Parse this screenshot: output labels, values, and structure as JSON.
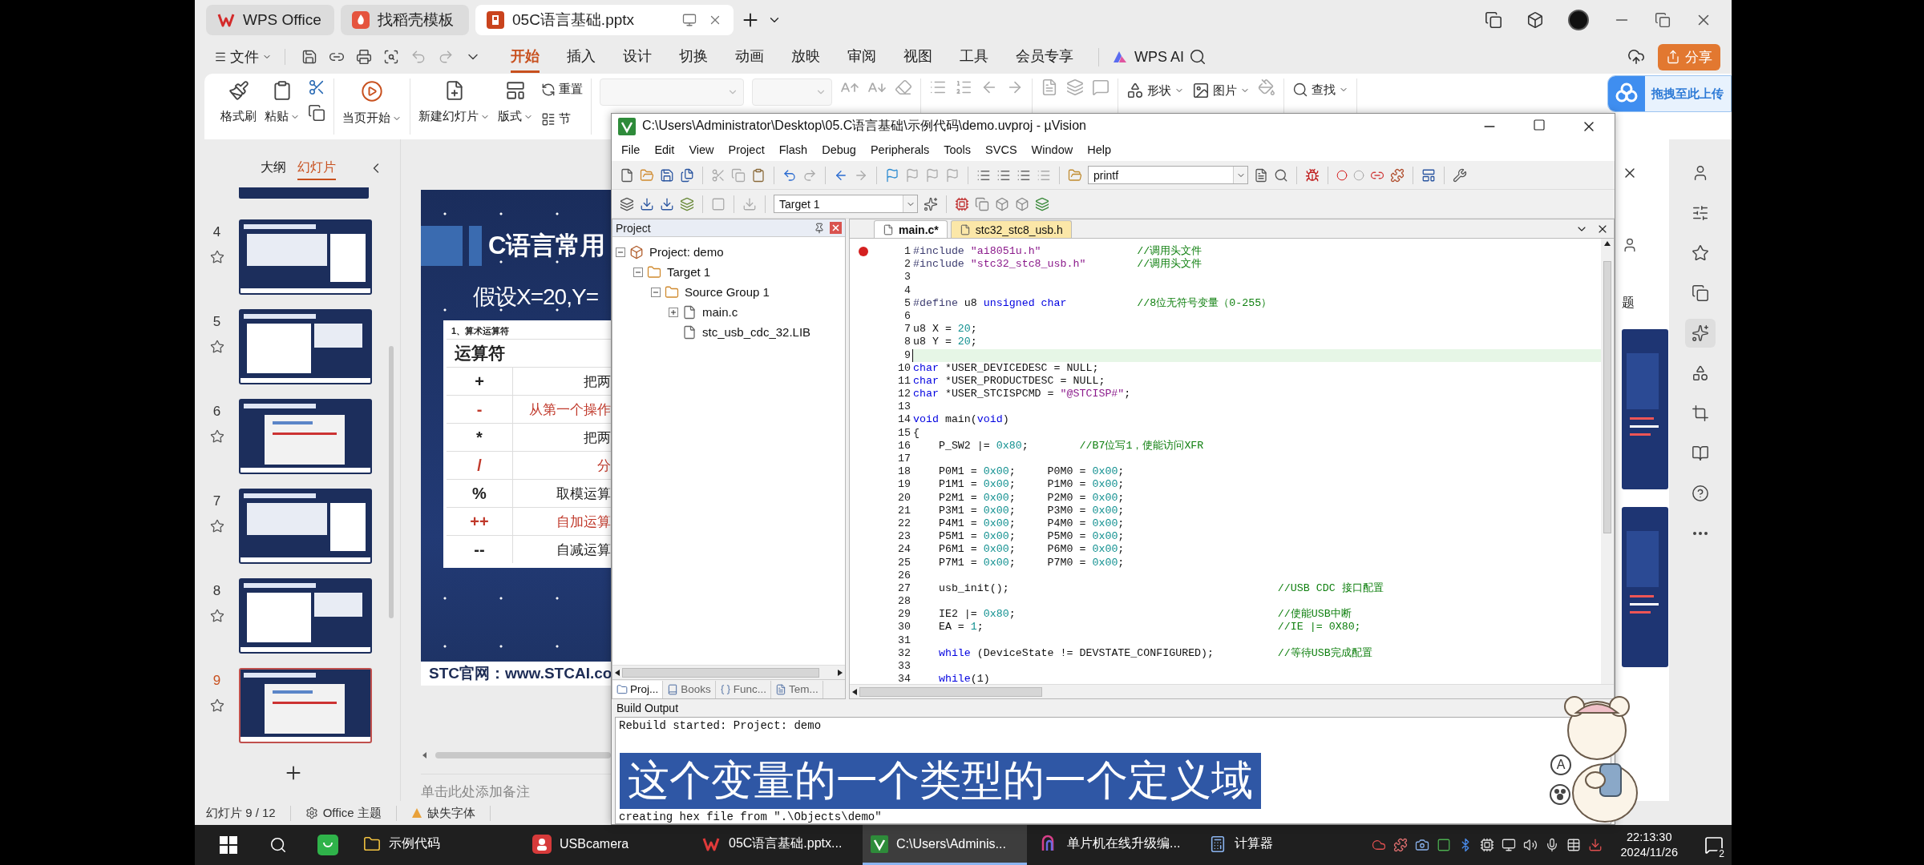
{
  "wps": {
    "tabs": [
      {
        "label": "WPS Office",
        "kind": "home",
        "selected": false
      },
      {
        "label": "找稻壳模板",
        "kind": "template",
        "selected": false
      },
      {
        "label": "05C语言基础.pptx",
        "kind": "document",
        "selected": true
      }
    ],
    "file_menu": "文件",
    "menu": [
      {
        "label": "开始",
        "selected": true
      },
      {
        "label": "插入",
        "selected": false
      },
      {
        "label": "设计",
        "selected": false
      },
      {
        "label": "切换",
        "selected": false
      },
      {
        "label": "动画",
        "selected": false
      },
      {
        "label": "放映",
        "selected": false
      },
      {
        "label": "审阅",
        "selected": false
      },
      {
        "label": "视图",
        "selected": false
      },
      {
        "label": "工具",
        "selected": false
      },
      {
        "label": "会员专享",
        "selected": false
      }
    ],
    "ai": "WPS AI",
    "share": "分享",
    "ribbon": {
      "format_painter": "格式刷",
      "paste": "粘贴",
      "play": "当页开始",
      "new_slide": "新建幻灯片",
      "layout": "版式",
      "reset": "重置",
      "section": "节",
      "shape": "形状",
      "picture": "图片",
      "find": "查找"
    },
    "upload_bubble": "拖拽至此上传",
    "panel": {
      "tabs": [
        {
          "label": "大纲",
          "selected": false
        },
        {
          "label": "幻灯片",
          "selected": true
        }
      ],
      "previous_sliver": true,
      "thumbnails": [
        {
          "number": "4",
          "selected": false
        },
        {
          "number": "5",
          "selected": false
        },
        {
          "number": "6",
          "selected": false
        },
        {
          "number": "7",
          "selected": false
        },
        {
          "number": "8",
          "selected": false
        },
        {
          "number": "9",
          "selected": true
        }
      ]
    },
    "slide": {
      "title": "C语言常用",
      "subtitle": "假设X=20,Y=",
      "caption": "1、算术运算符",
      "header": "运算符",
      "rows": [
        {
          "operator": "+",
          "text": "把两",
          "color": "#222222"
        },
        {
          "operator": "-",
          "text": "从第一个操作",
          "color": "#c0392b"
        },
        {
          "operator": "*",
          "text": "把两",
          "color": "#222222"
        },
        {
          "operator": "/",
          "text": "分",
          "color": "#c0392b"
        },
        {
          "operator": "%",
          "text": "取模运算",
          "color": "#222222"
        },
        {
          "operator": "++",
          "text": "自加运算",
          "color": "#c0392b"
        },
        {
          "operator": "--",
          "text": "自减运算",
          "color": "#222222"
        }
      ],
      "footer": "STC官网：www.STCAI.co"
    },
    "notes_placeholder": "单击此处添加备注",
    "side_pane": {
      "title_fragment": "题"
    },
    "side_tools": [
      {
        "selected": false
      },
      {
        "selected": false
      },
      {
        "selected": false
      },
      {
        "selected": false
      },
      {
        "selected": true
      },
      {
        "selected": false
      },
      {
        "selected": false
      },
      {
        "selected": false
      },
      {
        "selected": false
      },
      {
        "selected": false
      }
    ],
    "status": {
      "slide": "幻灯片 9 / 12",
      "theme": "Office 主题",
      "fonts": "缺失字体"
    }
  },
  "uvision": {
    "title": "C:\\Users\\Administrator\\Desktop\\05.C语言基础\\示例代码\\demo.uvproj - µVision",
    "menu": [
      "File",
      "Edit",
      "View",
      "Project",
      "Flash",
      "Debug",
      "Peripherals",
      "Tools",
      "SVCS",
      "Window",
      "Help"
    ],
    "find_value": "printf",
    "target": "Target 1",
    "project_pane": {
      "title": "Project",
      "tree": [
        {
          "label": "Project: demo",
          "kind": "project",
          "expanded": true,
          "children": [
            {
              "label": "Target 1",
              "kind": "target",
              "expanded": true,
              "children": [
                {
                  "label": "Source Group 1",
                  "kind": "group",
                  "expanded": true,
                  "children": [
                    {
                      "label": "main.c",
                      "kind": "file",
                      "expanded": false
                    },
                    {
                      "label": "stc_usb_cdc_32.LIB",
                      "kind": "file"
                    }
                  ]
                }
              ]
            }
          ]
        }
      ],
      "tabs": [
        {
          "label": "Proj...",
          "kind": "project",
          "selected": true
        },
        {
          "label": "Books",
          "kind": "books",
          "selected": false
        },
        {
          "label": "Func...",
          "kind": "functions",
          "selected": false
        },
        {
          "label": "Tem...",
          "kind": "templates",
          "selected": false
        }
      ]
    },
    "editor": {
      "tabs": [
        {
          "label": "main.c*",
          "selected": true
        },
        {
          "label": "stc32_stc8_usb.h",
          "selected": false
        }
      ],
      "lines": [
        {
          "n": "1",
          "breakpoint": true,
          "current": false,
          "parts": [
            {
              "kind": "pp",
              "text": "#include "
            },
            {
              "kind": "str",
              "text": "\"ai8051u.h\"               "
            },
            {
              "kind": "cmt",
              "text": "//调用头文件"
            }
          ]
        },
        {
          "n": "2",
          "breakpoint": false,
          "current": false,
          "parts": [
            {
              "kind": "pp",
              "text": "#include "
            },
            {
              "kind": "str",
              "text": "\"stc32_stc8_usb.h\"        "
            },
            {
              "kind": "cmt",
              "text": "//调用头文件"
            }
          ]
        },
        {
          "n": "3",
          "breakpoint": false,
          "current": false
        },
        {
          "n": "4",
          "breakpoint": false,
          "current": false
        },
        {
          "n": "5",
          "breakpoint": false,
          "current": false,
          "parts": [
            {
              "kind": "pp",
              "text": "#define "
            },
            {
              "kind": "txt",
              "text": "u8 "
            },
            {
              "kind": "kw",
              "text": "unsigned char           "
            },
            {
              "kind": "cmt",
              "text": "//8位无符号变量（0-255）"
            }
          ]
        },
        {
          "n": "6",
          "breakpoint": false,
          "current": false
        },
        {
          "n": "7",
          "breakpoint": false,
          "current": false,
          "parts": [
            {
              "kind": "txt",
              "text": "u8 X = "
            },
            {
              "kind": "num",
              "text": "20"
            },
            {
              "kind": "txt",
              "text": ";"
            }
          ]
        },
        {
          "n": "8",
          "breakpoint": false,
          "current": false,
          "parts": [
            {
              "kind": "txt",
              "text": "u8 Y = "
            },
            {
              "kind": "num",
              "text": "20"
            },
            {
              "kind": "txt",
              "text": ";"
            }
          ]
        },
        {
          "n": "9",
          "breakpoint": false,
          "current": true
        },
        {
          "n": "10",
          "breakpoint": false,
          "current": false,
          "parts": [
            {
              "kind": "kw",
              "text": "char"
            },
            {
              "kind": "txt",
              "text": " *USER_DEVICEDESC = NULL;"
            }
          ]
        },
        {
          "n": "11",
          "breakpoint": false,
          "current": false,
          "parts": [
            {
              "kind": "kw",
              "text": "char"
            },
            {
              "kind": "txt",
              "text": " *USER_PRODUCTDESC = NULL;"
            }
          ]
        },
        {
          "n": "12",
          "breakpoint": false,
          "current": false,
          "parts": [
            {
              "kind": "kw",
              "text": "char"
            },
            {
              "kind": "txt",
              "text": " *USER_STCISPCMD = "
            },
            {
              "kind": "str",
              "text": "\"@STCISP#\""
            },
            {
              "kind": "txt",
              "text": ";"
            }
          ]
        },
        {
          "n": "13",
          "breakpoint": false,
          "current": false
        },
        {
          "n": "14",
          "breakpoint": false,
          "current": false,
          "parts": [
            {
              "kind": "kw",
              "text": "void"
            },
            {
              "kind": "txt",
              "text": " main("
            },
            {
              "kind": "kw",
              "text": "void"
            },
            {
              "kind": "txt",
              "text": ")"
            }
          ]
        },
        {
          "n": "15",
          "breakpoint": false,
          "current": false,
          "parts": [
            {
              "kind": "txt",
              "text": "{"
            }
          ]
        },
        {
          "n": "16",
          "breakpoint": false,
          "current": false,
          "parts": [
            {
              "kind": "txt",
              "text": "    P_SW2 |= "
            },
            {
              "kind": "num",
              "text": "0x80"
            },
            {
              "kind": "txt",
              "text": ";        "
            },
            {
              "kind": "cmt",
              "text": "//B7位写1，使能访问XFR"
            }
          ]
        },
        {
          "n": "17",
          "breakpoint": false,
          "current": false
        },
        {
          "n": "18",
          "breakpoint": false,
          "current": false,
          "parts": [
            {
              "kind": "txt",
              "text": "    P0M1 = "
            },
            {
              "kind": "num",
              "text": "0x00"
            },
            {
              "kind": "txt",
              "text": ";     P0M0 = "
            },
            {
              "kind": "num",
              "text": "0x00"
            },
            {
              "kind": "txt",
              "text": ";"
            }
          ]
        },
        {
          "n": "19",
          "breakpoint": false,
          "current": false,
          "parts": [
            {
              "kind": "txt",
              "text": "    P1M1 = "
            },
            {
              "kind": "num",
              "text": "0x00"
            },
            {
              "kind": "txt",
              "text": ";     P1M0 = "
            },
            {
              "kind": "num",
              "text": "0x00"
            },
            {
              "kind": "txt",
              "text": ";"
            }
          ]
        },
        {
          "n": "20",
          "breakpoint": false,
          "current": false,
          "parts": [
            {
              "kind": "txt",
              "text": "    P2M1 = "
            },
            {
              "kind": "num",
              "text": "0x00"
            },
            {
              "kind": "txt",
              "text": ";     P2M0 = "
            },
            {
              "kind": "num",
              "text": "0x00"
            },
            {
              "kind": "txt",
              "text": ";"
            }
          ]
        },
        {
          "n": "21",
          "breakpoint": false,
          "current": false,
          "parts": [
            {
              "kind": "txt",
              "text": "    P3M1 = "
            },
            {
              "kind": "num",
              "text": "0x00"
            },
            {
              "kind": "txt",
              "text": ";     P3M0 = "
            },
            {
              "kind": "num",
              "text": "0x00"
            },
            {
              "kind": "txt",
              "text": ";"
            }
          ]
        },
        {
          "n": "22",
          "breakpoint": false,
          "current": false,
          "parts": [
            {
              "kind": "txt",
              "text": "    P4M1 = "
            },
            {
              "kind": "num",
              "text": "0x00"
            },
            {
              "kind": "txt",
              "text": ";     P4M0 = "
            },
            {
              "kind": "num",
              "text": "0x00"
            },
            {
              "kind": "txt",
              "text": ";"
            }
          ]
        },
        {
          "n": "23",
          "breakpoint": false,
          "current": false,
          "parts": [
            {
              "kind": "txt",
              "text": "    P5M1 = "
            },
            {
              "kind": "num",
              "text": "0x00"
            },
            {
              "kind": "txt",
              "text": ";     P5M0 = "
            },
            {
              "kind": "num",
              "text": "0x00"
            },
            {
              "kind": "txt",
              "text": ";"
            }
          ]
        },
        {
          "n": "24",
          "breakpoint": false,
          "current": false,
          "parts": [
            {
              "kind": "txt",
              "text": "    P6M1 = "
            },
            {
              "kind": "num",
              "text": "0x00"
            },
            {
              "kind": "txt",
              "text": ";     P6M0 = "
            },
            {
              "kind": "num",
              "text": "0x00"
            },
            {
              "kind": "txt",
              "text": ";"
            }
          ]
        },
        {
          "n": "25",
          "breakpoint": false,
          "current": false,
          "parts": [
            {
              "kind": "txt",
              "text": "    P7M1 = "
            },
            {
              "kind": "num",
              "text": "0x00"
            },
            {
              "kind": "txt",
              "text": ";     P7M0 = "
            },
            {
              "kind": "num",
              "text": "0x00"
            },
            {
              "kind": "txt",
              "text": ";"
            }
          ]
        },
        {
          "n": "26",
          "breakpoint": false,
          "current": false
        },
        {
          "n": "27",
          "breakpoint": false,
          "current": false,
          "parts": [
            {
              "kind": "txt",
              "text": "    usb_init();                                          "
            },
            {
              "kind": "cmt",
              "text": "//USB CDC 接口配置"
            }
          ]
        },
        {
          "n": "28",
          "breakpoint": false,
          "current": false
        },
        {
          "n": "29",
          "breakpoint": false,
          "current": false,
          "parts": [
            {
              "kind": "txt",
              "text": "    IE2 |= "
            },
            {
              "kind": "num",
              "text": "0x80"
            },
            {
              "kind": "txt",
              "text": ";                                         "
            },
            {
              "kind": "cmt",
              "text": "//使能USB中断"
            }
          ]
        },
        {
          "n": "30",
          "breakpoint": false,
          "current": false,
          "parts": [
            {
              "kind": "txt",
              "text": "    EA = "
            },
            {
              "kind": "num",
              "text": "1"
            },
            {
              "kind": "txt",
              "text": ";                                              "
            },
            {
              "kind": "cmt",
              "text": "//IE |= 0X80;"
            }
          ]
        },
        {
          "n": "31",
          "breakpoint": false,
          "current": false
        },
        {
          "n": "32",
          "breakpoint": false,
          "current": false,
          "parts": [
            {
              "kind": "kw",
              "text": "    while"
            },
            {
              "kind": "txt",
              "text": " (DeviceState != DEVSTATE_CONFIGURED);          "
            },
            {
              "kind": "cmt",
              "text": "//等待USB完成配置"
            }
          ]
        },
        {
          "n": "33",
          "breakpoint": false,
          "current": false
        },
        {
          "n": "34",
          "breakpoint": false,
          "current": false,
          "parts": [
            {
              "kind": "kw",
              "text": "    while"
            },
            {
              "kind": "txt",
              "text": "(1)"
            }
          ]
        }
      ]
    },
    "build_output": {
      "title": "Build Output",
      "lines": [
        "Rebuild started: Project: demo",
        "creating hex file from \".\\Objects\\demo\""
      ]
    }
  },
  "subtitle": "这个变量的一个类型的一个定义域",
  "sticker": {
    "badge": "A"
  },
  "taskbar": {
    "items": [
      {
        "label": "示例代码",
        "kind": "folder",
        "selected": false
      },
      {
        "label": "USBcamera",
        "kind": "camera",
        "selected": false
      },
      {
        "label": "05C语言基础.pptx...",
        "kind": "wps",
        "selected": false
      },
      {
        "label": "C:\\Users\\Adminis...",
        "kind": "uvision",
        "selected": true
      },
      {
        "label": "单片机在线升级编...",
        "kind": "upgrade",
        "selected": false
      },
      {
        "label": "计算器",
        "kind": "calculator",
        "selected": false
      }
    ],
    "time": "22:13:30",
    "date": "2024/11/26",
    "notifications": "2"
  }
}
